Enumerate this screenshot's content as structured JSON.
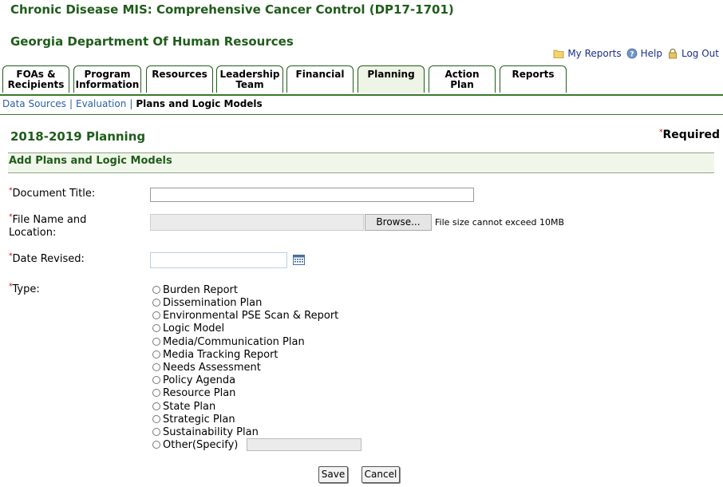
{
  "header": {
    "app_title": "Chronic Disease MIS: Comprehensive Cancer Control (DP17-1701)",
    "org_name": "Georgia Department Of Human Resources"
  },
  "utility_links": [
    {
      "label": "My Reports",
      "icon": "folder-icon"
    },
    {
      "label": "Help",
      "icon": "help-icon"
    },
    {
      "label": "Log Out",
      "icon": "lock-icon"
    }
  ],
  "tabs": [
    {
      "label": "FOAs &\nRecipients"
    },
    {
      "label": "Program\nInformation"
    },
    {
      "label": "Resources"
    },
    {
      "label": "Leadership\nTeam"
    },
    {
      "label": "Financial"
    },
    {
      "label": "Planning",
      "active": true
    },
    {
      "label": "Action\nPlan"
    },
    {
      "label": "Reports"
    }
  ],
  "subnav": {
    "links": [
      "Data Sources",
      "Evaluation"
    ],
    "current": "Plans and Logic Models"
  },
  "section": {
    "title": "2018-2019 Planning",
    "required_note": "Required"
  },
  "panel": {
    "title": "Add Plans and Logic Models"
  },
  "form": {
    "document_title_label": "Document Title:",
    "document_title_value": "",
    "file_label_line1": "File Name and",
    "file_label_line2": "Location:",
    "browse_label": "Browse...",
    "file_note": "File size cannot exceed 10MB",
    "date_label": "Date Revised:",
    "date_value": "",
    "type_label": "Type:",
    "type_options": [
      "Burden Report",
      "Dissemination Plan",
      "Environmental PSE Scan & Report",
      "Logic Model",
      "Media/Communication Plan",
      "Media Tracking Report",
      "Needs Assessment",
      "Policy Agenda",
      "Resource Plan",
      "State Plan",
      "Strategic Plan",
      "Sustainability Plan",
      "Other(Specify)"
    ],
    "other_value": ""
  },
  "buttons": {
    "save": "Save",
    "cancel": "Cancel"
  },
  "colors": {
    "brand_green": "#1f5d1a",
    "link_blue": "#2b5fa8",
    "required_red": "#cc0000"
  }
}
